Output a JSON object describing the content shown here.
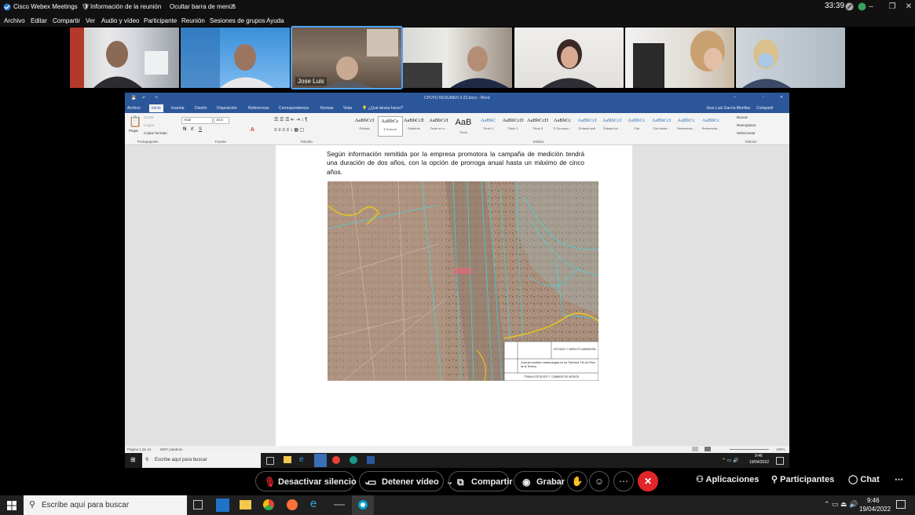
{
  "app": {
    "title": "Cisco Webex Meetings",
    "meeting_info": "Información de la reunión",
    "hide_menu": "Ocultar barra de menús",
    "timer": "33:39"
  },
  "menu": [
    "Archivo",
    "Editar",
    "Compartir",
    "Ver",
    "Audio y vídeo",
    "Participante",
    "Reunión",
    "Sesiones de grupos",
    "Ayuda"
  ],
  "participants": [
    {
      "name": ""
    },
    {
      "name": ""
    },
    {
      "name": "Jose Luis"
    },
    {
      "name": ""
    },
    {
      "name": ""
    },
    {
      "name": ""
    },
    {
      "name": ""
    }
  ],
  "word": {
    "title": "CPOTU RESUMEN 3-22.docx - Word",
    "user": "Jose Luis García Morillas",
    "share": "Compartir",
    "tabs": [
      "Archivo",
      "Inicio",
      "Insertar",
      "Diseño",
      "Disposición",
      "Referencias",
      "Correspondencia",
      "Revisar",
      "Vista"
    ],
    "tellme": "¿Qué desea hacer?",
    "clipboard": {
      "paste": "Pegar",
      "cut": "Cortar",
      "copy": "Copiar",
      "format": "Copiar formato",
      "group": "Portapapeles"
    },
    "font": {
      "name": "Arial",
      "size": "10,5",
      "group": "Fuente"
    },
    "paragraph_group": "Párrafo",
    "styles": [
      {
        "preview": "AaBbCcI",
        "name": "Énfasis"
      },
      {
        "preview": "AaBbCc",
        "name": "¶ Normal"
      },
      {
        "preview": "AaBbCcE",
        "name": "Subtítulo"
      },
      {
        "preview": "AaBbCcI",
        "name": "Texto en n..."
      },
      {
        "preview": "AaB",
        "name": "Título"
      },
      {
        "preview": "AaBbC",
        "name": "Título 1"
      },
      {
        "preview": "AaBbCcD",
        "name": "Título 2"
      },
      {
        "preview": "AaBbCcD",
        "name": "Título 3"
      },
      {
        "preview": "AaBbCc",
        "name": "¶ Sin espa..."
      },
      {
        "preview": "AaBbCcI",
        "name": "Énfasis sutil"
      },
      {
        "preview": "AaBbCcI",
        "name": "Énfasis int..."
      },
      {
        "preview": "AaBbCc",
        "name": "Cita"
      },
      {
        "preview": "AaBbCcI",
        "name": "Cita desta..."
      },
      {
        "preview": "AaBbCc",
        "name": "Referencia..."
      },
      {
        "preview": "AaBbCc",
        "name": "Referencia..."
      }
    ],
    "styles_group": "Estilos",
    "editing": {
      "find": "Buscar",
      "replace": "Reemplazar",
      "select": "Seleccionar",
      "group": "Edición"
    },
    "paragraph_text": "Según información remitida por la empresa promotora la campaña de medición tendrá una duración de dos años, con la opción de prorroga anual hasta un máximo de cinco años.",
    "map_legend": {
      "row1": "ESTUDIO T. IMPACTO AMBIENTAL",
      "row2": "Zona de medición meteorológica en los Términos T.M. de Pinto de la Ternera",
      "row3": "TOMA A ESTUDIOS T. CAMBIOS DE MODOS"
    },
    "status": {
      "page": "Página 1 de 43",
      "words": "8097 palabras",
      "zoom": "130%"
    },
    "inner_search": "Escribe aquí para buscar",
    "inner_time": "9:46",
    "inner_date": "19/04/2022"
  },
  "controls": {
    "mute": "Desactivar silencio",
    "video": "Detener vídeo",
    "share": "Compartir",
    "record": "Grabar",
    "apps": "Aplicaciones",
    "participants": "Participantes",
    "chat": "Chat"
  },
  "taskbar": {
    "search": "Escribe aquí para buscar",
    "time": "9:46",
    "date": "19/04/2022"
  },
  "colors": {
    "word_blue": "#2b579a",
    "end_red": "#e0262a",
    "active_outline": "#4da3ff"
  }
}
